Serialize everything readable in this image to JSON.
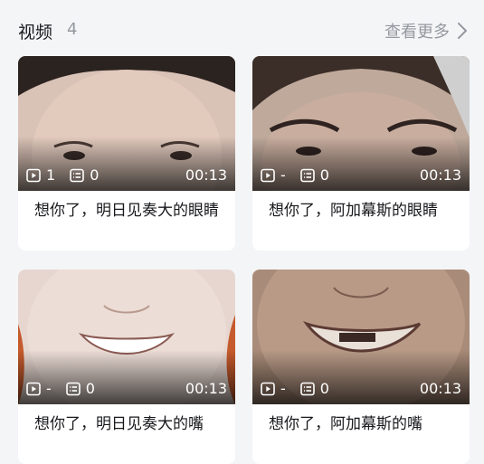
{
  "header": {
    "title": "视频",
    "count": "4",
    "more_label": "查看更多"
  },
  "videos": [
    {
      "plays": "1",
      "comments": "0",
      "duration": "00:13",
      "title": "想你了，明日见奏大的眼睛"
    },
    {
      "plays": "-",
      "comments": "0",
      "duration": "00:13",
      "title": "想你了，阿加幕斯的眼睛"
    },
    {
      "plays": "-",
      "comments": "0",
      "duration": "00:13",
      "title": "想你了，明日见奏大的嘴"
    },
    {
      "plays": "-",
      "comments": "0",
      "duration": "00:13",
      "title": "想你了，阿加幕斯的嘴"
    }
  ],
  "icons": {
    "play": "play-icon",
    "comment": "danmaku-icon",
    "more": "chevron-right-icon"
  }
}
